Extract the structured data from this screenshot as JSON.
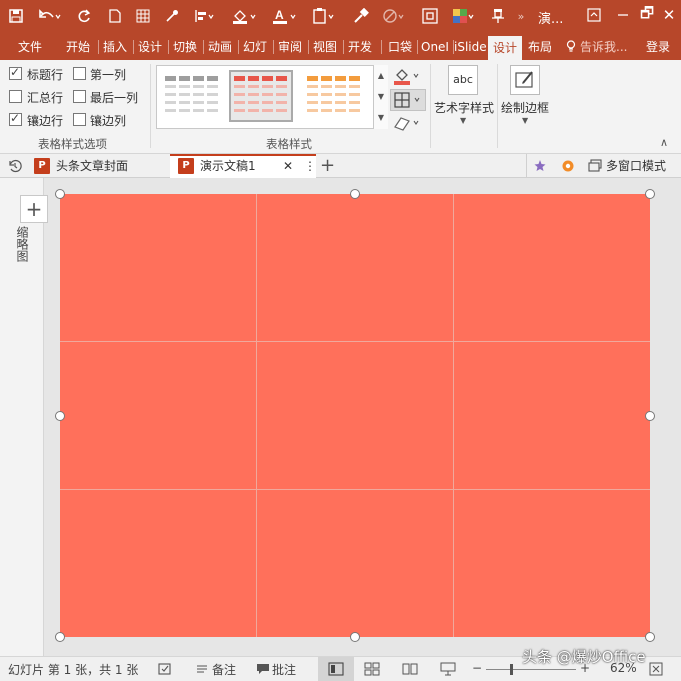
{
  "app": {
    "title": "演...",
    "accent": "#b7472a",
    "table_fill": "#ff705b"
  },
  "qat": {
    "icons": [
      "save-icon",
      "undo-icon",
      "redo-icon",
      "new-doc-icon",
      "grid-icon",
      "eyedropper-icon",
      "align-icon",
      "fill-color-icon",
      "font-color-icon",
      "paste-icon",
      "format-painter-icon",
      "no-entry-icon",
      "crop-icon",
      "color-theme-icon",
      "pin-icon",
      "more-icon"
    ]
  },
  "window": {
    "restore_label": "🗗",
    "close_label": "✕"
  },
  "tabs": [
    {
      "label": "文件"
    },
    {
      "label": "开始"
    },
    {
      "label": "插入"
    },
    {
      "label": "设计"
    },
    {
      "label": "切换"
    },
    {
      "label": "动画"
    },
    {
      "label": "幻灯"
    },
    {
      "label": "审阅"
    },
    {
      "label": "视图"
    },
    {
      "label": "开发"
    },
    {
      "label": "口袋"
    },
    {
      "label": "OneI"
    },
    {
      "label": "iSlide"
    },
    {
      "label": "设计"
    },
    {
      "label": "布局"
    }
  ],
  "tellme": "告诉我...",
  "login": "登录",
  "ribbon": {
    "options": [
      {
        "label": "标题行",
        "checked": true
      },
      {
        "label": "第一列",
        "checked": false
      },
      {
        "label": "汇总行",
        "checked": false
      },
      {
        "label": "最后一列",
        "checked": false
      },
      {
        "label": "镶边行",
        "checked": true
      },
      {
        "label": "镶边列",
        "checked": false
      }
    ],
    "options_group": "表格样式选项",
    "styles_group": "表格样式",
    "wordart_label": "艺术字样式",
    "wordart_icon_text": "abc",
    "draw_border_label": "绘制边框",
    "style_colors": [
      "#9e9e9e",
      "#e8564a",
      "#f39c3d"
    ]
  },
  "doctabs": [
    {
      "label": "头条文章封面",
      "icon": "P"
    },
    {
      "label": "演示文稿1",
      "icon": "P"
    }
  ],
  "doctabs_extra": {
    "close": "✕",
    "more": "⋮",
    "add": "+",
    "multiwindow": "多窗口模式"
  },
  "leftpane": {
    "add": "+",
    "label": "缩略图"
  },
  "status": {
    "slide_info": "幻灯片 第 1 张，共 1 张",
    "notes": "备注",
    "comments": "批注",
    "zoom": "62%",
    "watermark": "头条 @爆炒Office"
  }
}
